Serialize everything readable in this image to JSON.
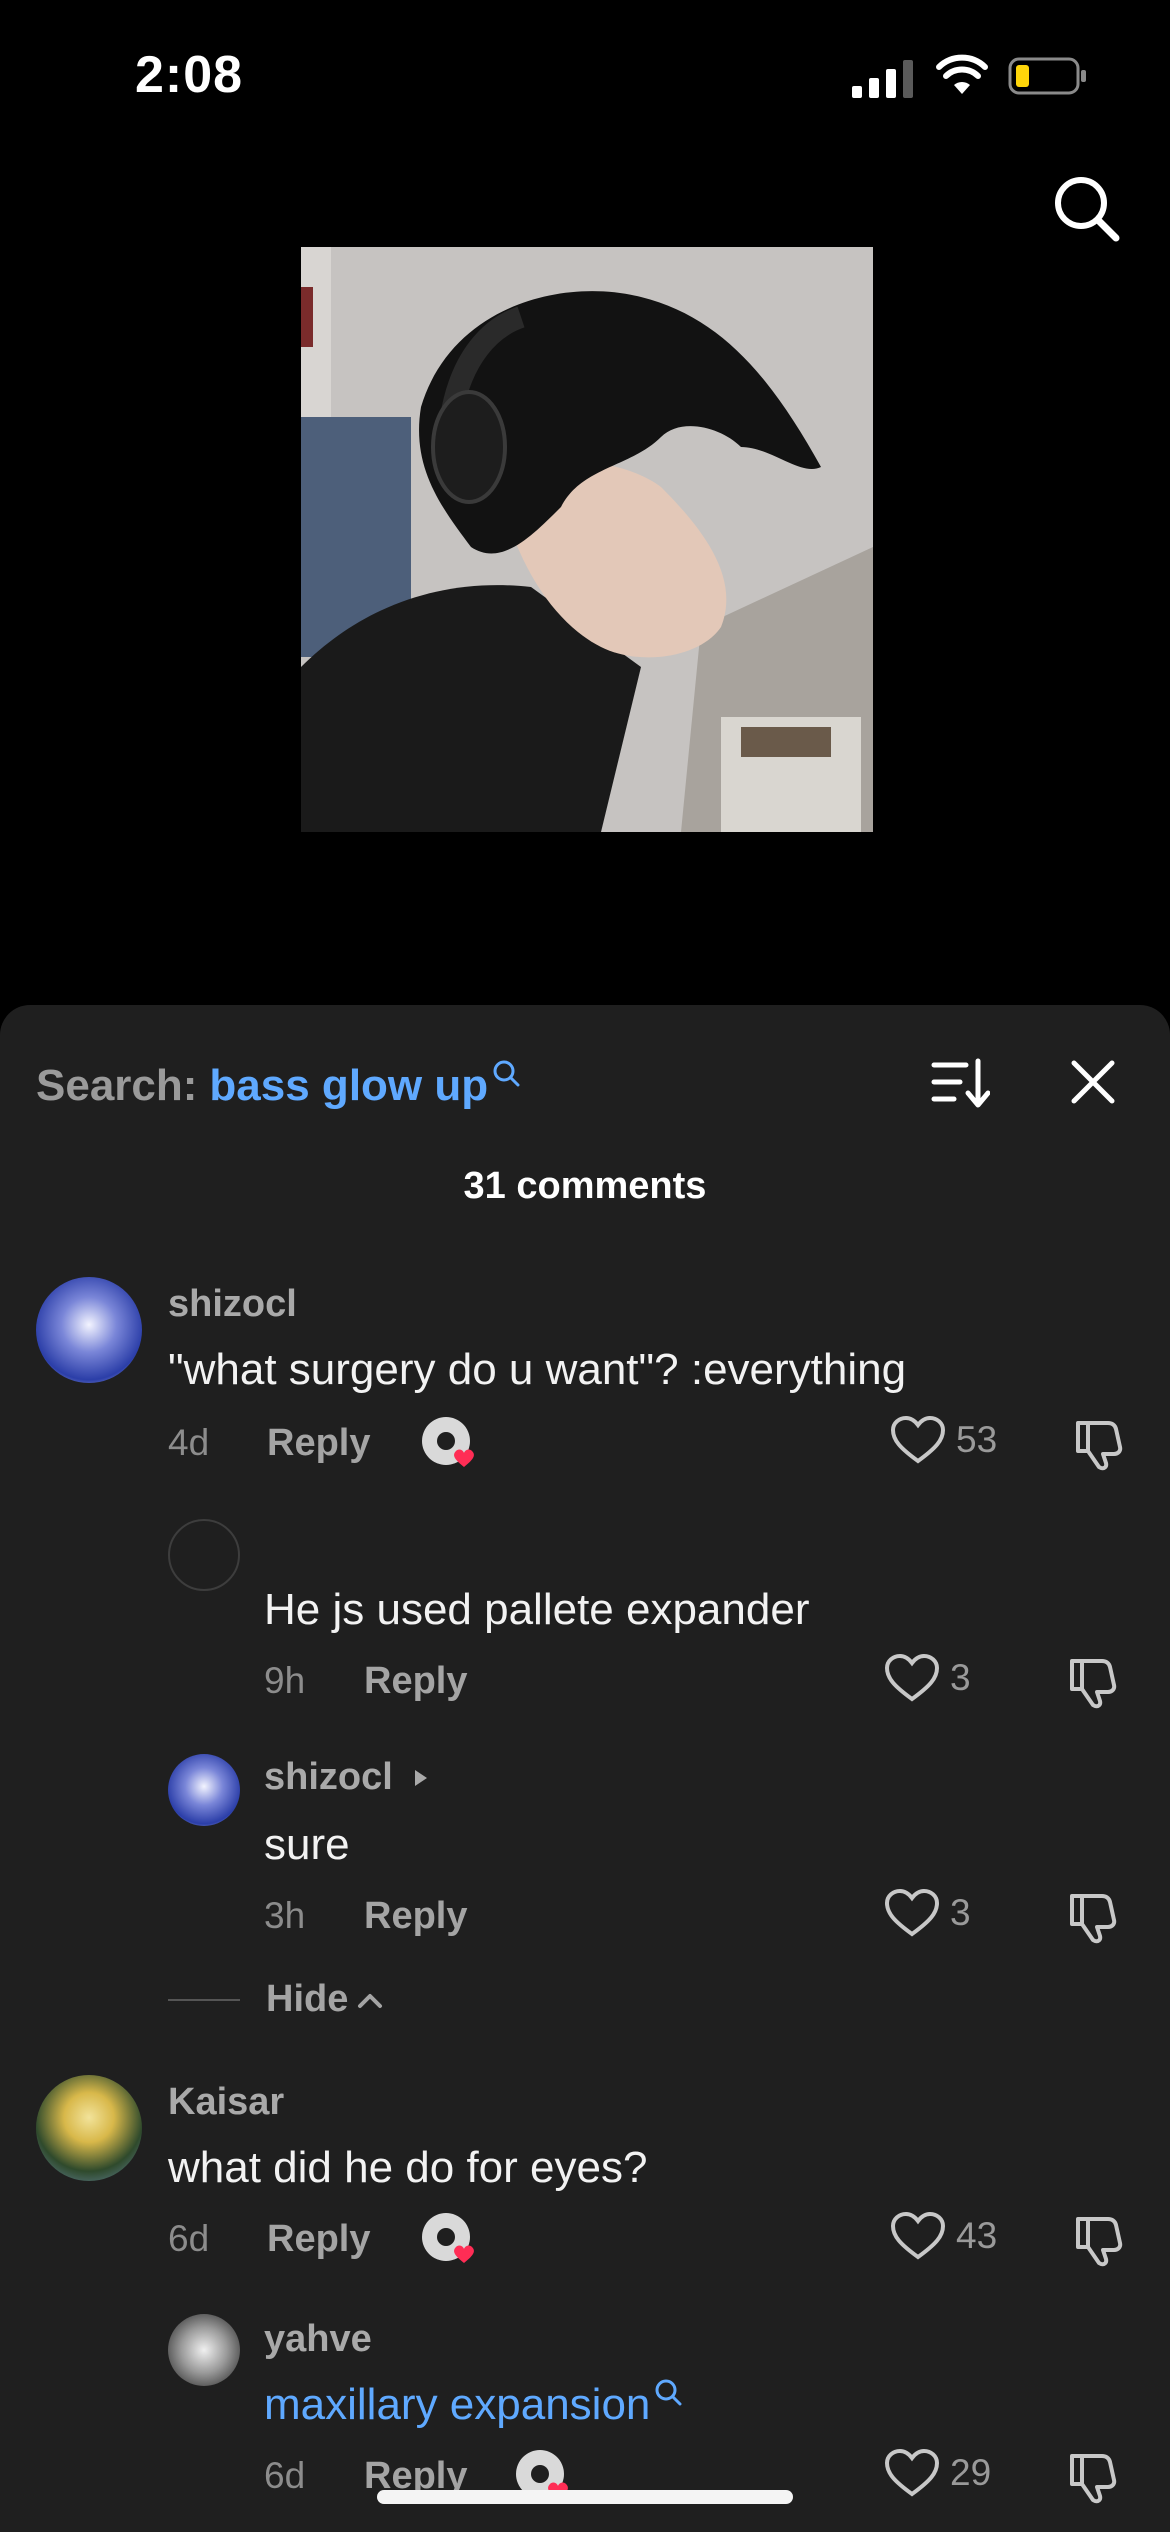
{
  "status": {
    "time": "2:08"
  },
  "search": {
    "label": "Search:",
    "term": "bass glow up"
  },
  "comments_count": "31 comments",
  "comments": [
    {
      "user": "shizocl",
      "text": "\"what surgery do u want\"? :everything",
      "age": "4d",
      "reply": "Reply",
      "likes": "53"
    },
    {
      "user": "",
      "text": "He js used pallete expander",
      "age": "9h",
      "reply": "Reply",
      "likes": "3"
    },
    {
      "user": "shizocl",
      "text": "sure",
      "age": "3h",
      "reply": "Reply",
      "likes": "3"
    },
    {
      "user": "Kaisar",
      "text": "what did he do for eyes?",
      "age": "6d",
      "reply": "Reply",
      "likes": "43"
    },
    {
      "user": "yahve",
      "text": "maxillary expansion",
      "age": "6d",
      "reply": "Reply",
      "likes": "29"
    }
  ],
  "hide_label": "Hide",
  "colors": {
    "accent": "#5fa9ff",
    "sheet": "#1f1f1f",
    "heart_badge": "#ff2d55"
  }
}
